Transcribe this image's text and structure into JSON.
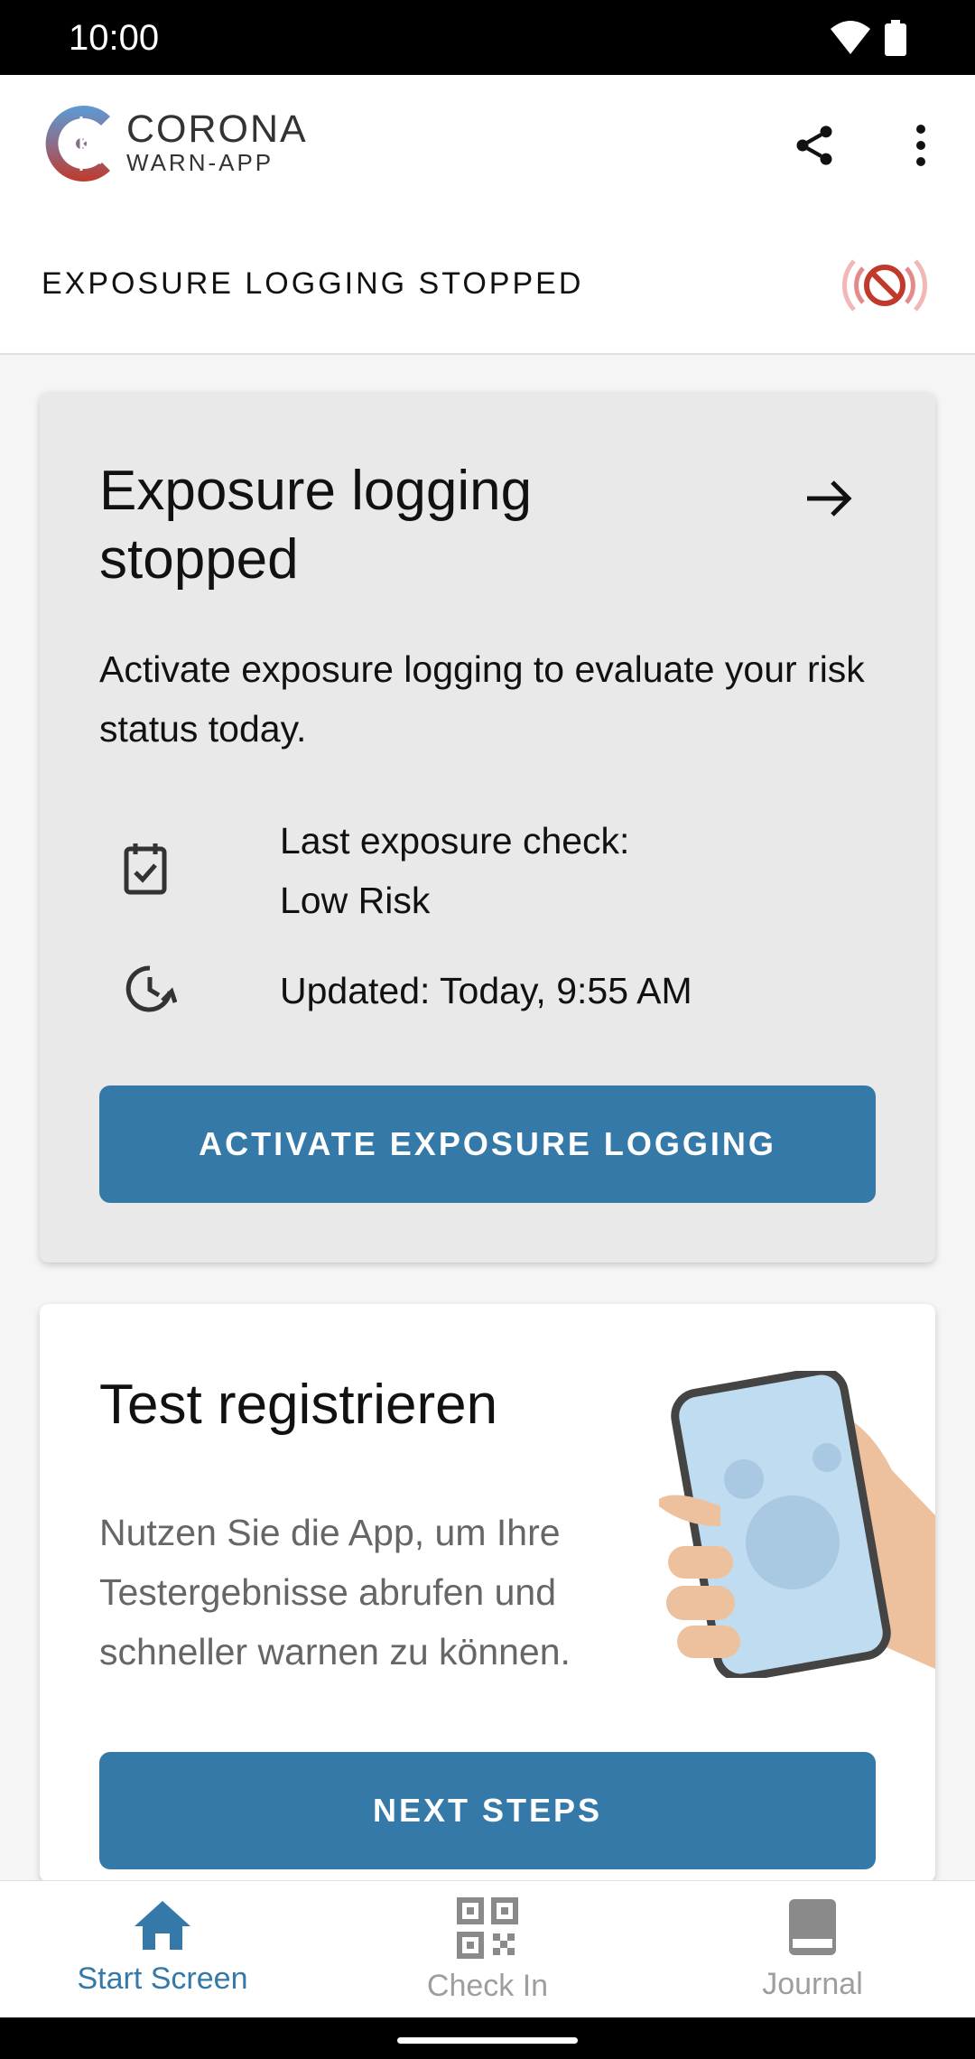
{
  "status_bar": {
    "time": "10:00"
  },
  "app_bar": {
    "brand_line1": "CORONA",
    "brand_line2": "WARN-APP",
    "share_icon": "share-icon",
    "more_icon": "more-vertical-icon"
  },
  "status_header": {
    "label": "EXPOSURE LOGGING STOPPED",
    "icon": "exposure-logging-off-icon"
  },
  "risk_card": {
    "title": "Exposure logging stopped",
    "description": "Activate exposure logging to evaluate your risk status today.",
    "last_check_label": "Last exposure check:",
    "last_check_value": "Low Risk",
    "updated": "Updated: Today, 9:55 AM",
    "button": "ACTIVATE EXPOSURE LOGGING"
  },
  "test_card": {
    "title": "Test registrieren",
    "description": "Nutzen Sie die App, um Ihre Testergebnisse abrufen und schneller warnen zu können.",
    "button": "NEXT STEPS"
  },
  "bottom_nav": {
    "items": [
      {
        "label": "Start Screen",
        "icon": "home-icon",
        "active": true
      },
      {
        "label": "Check In",
        "icon": "qr-code-icon",
        "active": false
      },
      {
        "label": "Journal",
        "icon": "book-icon",
        "active": false
      }
    ]
  },
  "colors": {
    "accent": "#3579a8",
    "risk_stopped_icon": "#c0392b"
  }
}
